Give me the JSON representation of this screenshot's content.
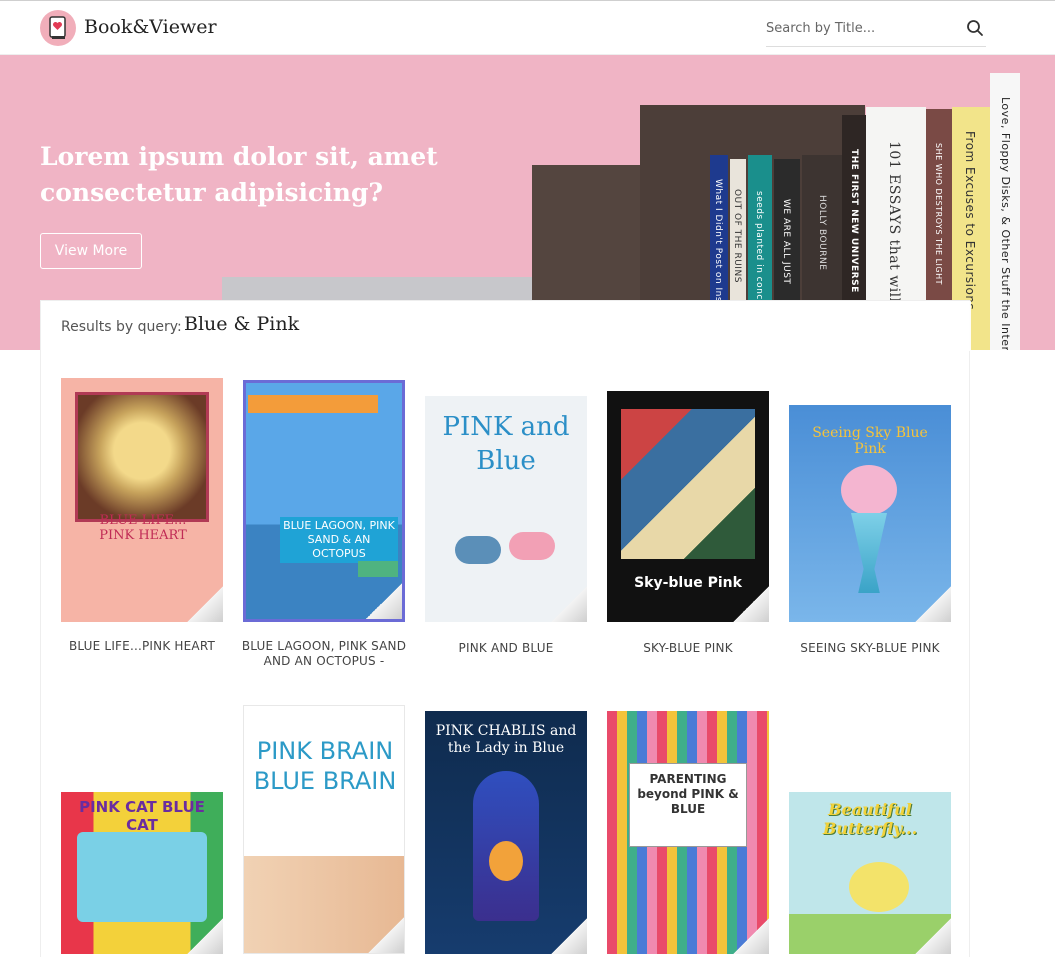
{
  "header": {
    "brand": "Book&Viewer",
    "search_placeholder": "Search by Title..."
  },
  "hero": {
    "title": "Lorem ipsum dolor sit, amet consectetur adipisicing?",
    "button_label": "View More",
    "spines": [
      "What I Didn't Post on Instagram",
      "OUT OF THE RUINS",
      "seeds planted in concrete",
      "WE ARE ALL JUST",
      "HOLLY BOURNE",
      "THE FIRST NEW UNIVERSE",
      "101 ESSAYS that will",
      "SHE WHO DESTROYS THE LIGHT",
      "From Excuses to Excursions",
      "Love, Floppy Disks, & Other Stuff the Internet"
    ]
  },
  "results": {
    "label": "Results by query:",
    "query": "Blue & Pink",
    "books": [
      {
        "title": "BLUE LIFE...PINK HEART",
        "cover_text": "BLUE LIFE... PINK HEART"
      },
      {
        "title": "BLUE LAGOON, PINK SAND AND AN OCTOPUS -",
        "cover_text": "BLUE LAGOON, PINK SAND & AN OCTOPUS"
      },
      {
        "title": "PINK AND BLUE",
        "cover_text": "PINK and Blue"
      },
      {
        "title": "SKY-BLUE PINK",
        "cover_text": "Sky-blue Pink"
      },
      {
        "title": "SEEING SKY-BLUE PINK",
        "cover_text": "Seeing Sky Blue Pink"
      },
      {
        "title": "",
        "cover_text": "PINK CAT BLUE CAT"
      },
      {
        "title": "",
        "cover_text": "PINK BRAIN BLUE BRAIN"
      },
      {
        "title": "",
        "cover_text": "PINK CHABLIS and the Lady in Blue"
      },
      {
        "title": "",
        "cover_text": "PARENTING beyond PINK & BLUE"
      },
      {
        "title": "",
        "cover_text": "Beautiful Butterfly..."
      }
    ]
  },
  "colors": {
    "hero_bg": "#f0b4c5",
    "logo_bg": "#f1aeba"
  }
}
